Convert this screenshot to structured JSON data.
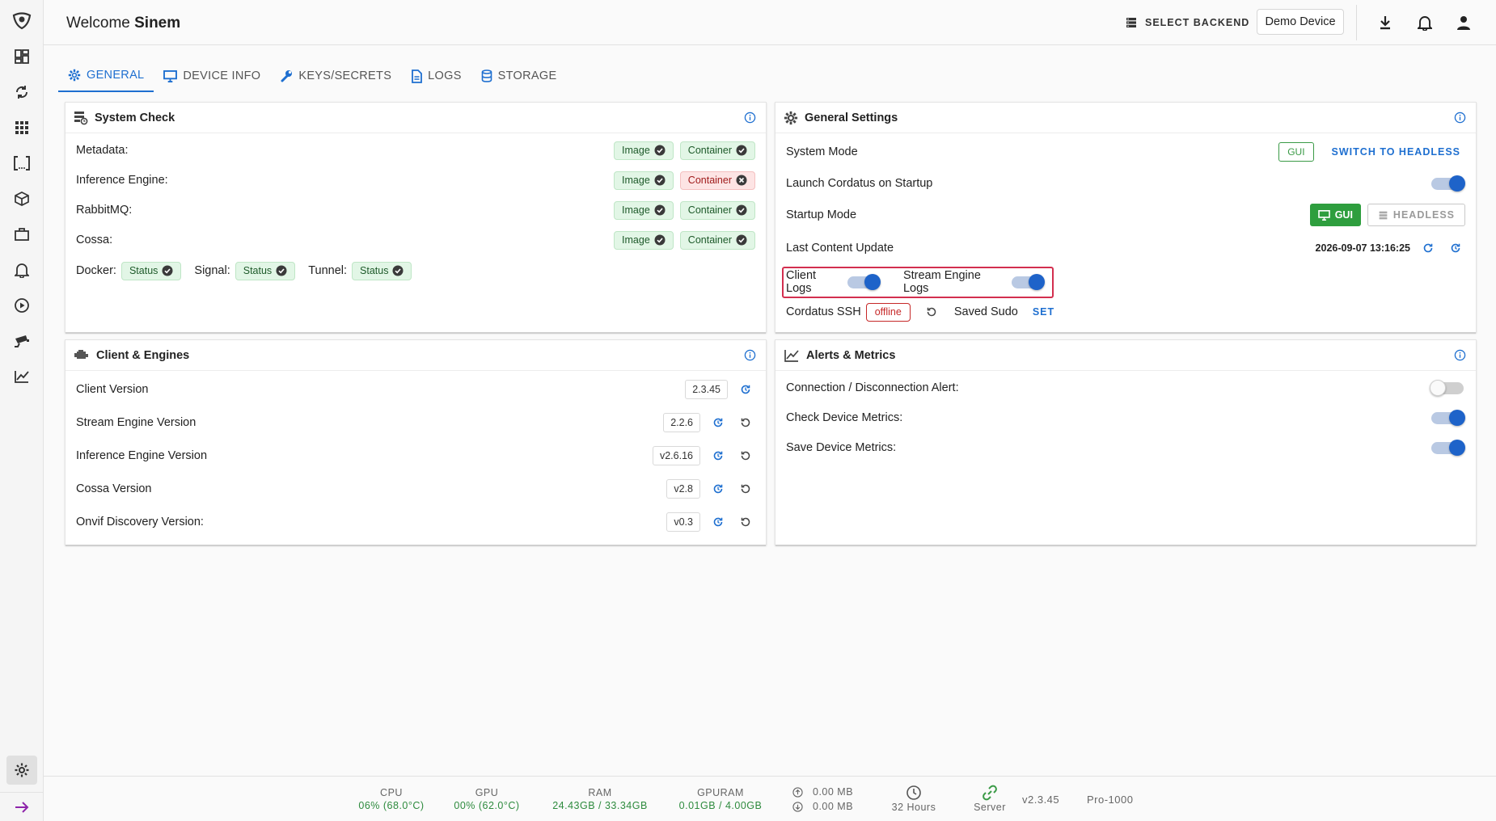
{
  "sidebar": {
    "items": [
      {
        "icon": "logo-icon"
      },
      {
        "icon": "dashboard-icon"
      },
      {
        "icon": "sync-icon"
      },
      {
        "icon": "apps-grid-icon"
      },
      {
        "icon": "brackets-icon"
      },
      {
        "icon": "cube-icon"
      },
      {
        "icon": "briefcase-icon"
      },
      {
        "icon": "bell-icon"
      },
      {
        "icon": "play-circle-icon"
      },
      {
        "icon": "cctv-camera-icon"
      },
      {
        "icon": "chart-line-icon"
      }
    ],
    "settings_icon": "gear-icon",
    "expand_icon": "arrow-right-icon"
  },
  "header": {
    "welcome_prefix": "Welcome",
    "user_name": "Sinem",
    "select_backend_label": "SELECT BACKEND",
    "device_label": "Demo Device"
  },
  "tabs": [
    {
      "label": "GENERAL",
      "icon": "gear-icon",
      "active": true
    },
    {
      "label": "DEVICE INFO",
      "icon": "monitor-icon",
      "active": false
    },
    {
      "label": "KEYS/SECRETS",
      "icon": "wrench-icon",
      "active": false
    },
    {
      "label": "LOGS",
      "icon": "file-icon",
      "active": false
    },
    {
      "label": "STORAGE",
      "icon": "database-icon",
      "active": false
    }
  ],
  "system_check": {
    "title": "System Check",
    "rows": [
      {
        "label": "Metadata:",
        "image": "Image",
        "container": "Container",
        "container_ok": true
      },
      {
        "label": "Inference Engine:",
        "image": "Image",
        "container": "Container",
        "container_ok": false
      },
      {
        "label": "RabbitMQ:",
        "image": "Image",
        "container": "Container",
        "container_ok": true
      },
      {
        "label": "Cossa:",
        "image": "Image",
        "container": "Container",
        "container_ok": true
      }
    ],
    "services": [
      {
        "label": "Docker:",
        "status": "Status"
      },
      {
        "label": "Signal:",
        "status": "Status"
      },
      {
        "label": "Tunnel:",
        "status": "Status"
      }
    ]
  },
  "general_settings": {
    "title": "General Settings",
    "system_mode_label": "System Mode",
    "system_mode_value": "GUI",
    "switch_headless_label": "SWITCH TO HEADLESS",
    "launch_startup_label": "Launch Cordatus on Startup",
    "launch_startup_on": true,
    "startup_mode_label": "Startup Mode",
    "startup_gui_label": "GUI",
    "startup_headless_label": "HEADLESS",
    "last_update_label": "Last Content Update",
    "last_update_value": "2026-09-07 13:16:25",
    "client_logs_label": "Client Logs",
    "client_logs_on": true,
    "stream_logs_label": "Stream Engine Logs",
    "stream_logs_on": true,
    "ssh_label": "Cordatus SSH",
    "ssh_status": "offline",
    "saved_sudo_label": "Saved Sudo",
    "set_label": "SET"
  },
  "client_engines": {
    "title": "Client & Engines",
    "rows": [
      {
        "label": "Client Version",
        "version": "2.3.45",
        "restart": false
      },
      {
        "label": "Stream Engine Version",
        "version": "2.2.6",
        "restart": true
      },
      {
        "label": "Inference Engine Version",
        "version": "v2.6.16",
        "restart": true
      },
      {
        "label": "Cossa Version",
        "version": "v2.8",
        "restart": true
      },
      {
        "label": "Onvif Discovery Version:",
        "version": "v0.3",
        "restart": true
      }
    ]
  },
  "alerts_metrics": {
    "title": "Alerts & Metrics",
    "rows": [
      {
        "label": "Connection / Disconnection Alert:",
        "on": false
      },
      {
        "label": "Check Device Metrics:",
        "on": true
      },
      {
        "label": "Save Device Metrics:",
        "on": true
      }
    ]
  },
  "statusbar": {
    "cpu_label": "CPU",
    "cpu_value": "06% (68.0°C)",
    "gpu_label": "GPU",
    "gpu_value": "00% (62.0°C)",
    "ram_label": "RAM",
    "ram_value": "24.43GB / 33.34GB",
    "gpuram_label": "GPURAM",
    "gpuram_value": "0.01GB / 4.00GB",
    "upload_value": "0.00 MB",
    "download_value": "0.00 MB",
    "uptime_value": "32 Hours",
    "server_label": "Server",
    "version": "v2.3.45",
    "plan": "Pro-1000"
  },
  "colors": {
    "accent": "#1e6fd0",
    "success": "#2e9e3e",
    "error": "#c62828",
    "highlight": "#d32f4f"
  }
}
